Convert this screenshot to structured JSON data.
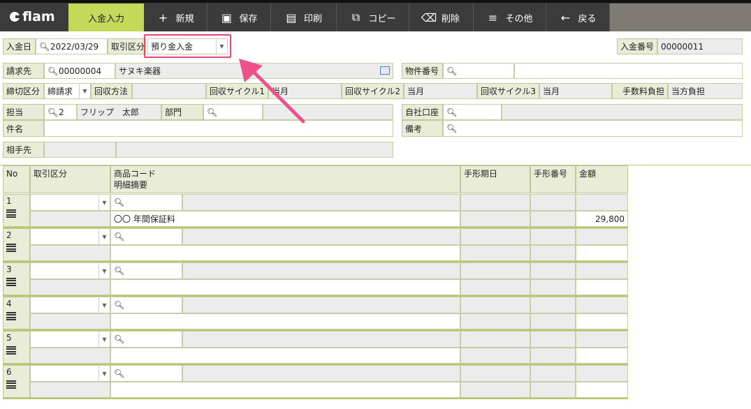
{
  "toolbar": {
    "logo": "flam",
    "tabs": [
      {
        "label": "入金入力",
        "icon": ""
      },
      {
        "label": "新規",
        "icon": "+"
      },
      {
        "label": "保存",
        "icon": "💾"
      },
      {
        "label": "印刷",
        "icon": "🖨"
      },
      {
        "label": "コピー",
        "icon": "⧉"
      },
      {
        "label": "削除",
        "icon": "🗑"
      },
      {
        "label": "その他",
        "icon": "≡"
      },
      {
        "label": "戻る",
        "icon": "←"
      }
    ]
  },
  "header": {
    "date_label": "入金日",
    "date_value": "2022/03/29",
    "type_label": "取引区分",
    "type_value": "預り金入金",
    "number_label": "入金番号",
    "number_value": "00000011"
  },
  "billing": {
    "label": "請求先",
    "code": "00000004",
    "name": "サヌキ楽器",
    "property_label": "物件番号"
  },
  "closing": {
    "label": "締切区分",
    "value": "締請求",
    "method_label": "回収方法",
    "cycle1_label": "回収サイクル1",
    "cycle1_value": "当月",
    "cycle2_label": "回収サイクル2",
    "cycle2_value": "当月",
    "cycle3_label": "回収サイクル3",
    "cycle3_value": "当月",
    "fee_label": "手数料負担",
    "fee_value": "当方負担"
  },
  "staff": {
    "label": "担当",
    "code": "2",
    "name": "フリップ　太郎",
    "dept_label": "部門",
    "account_label": "自社口座"
  },
  "subject": {
    "label": "件名",
    "note_label": "備考"
  },
  "partner": {
    "label": "相手先"
  },
  "table": {
    "headers": {
      "no": "No",
      "type": "取引区分",
      "product": "商品コード",
      "summary": "明細摘要",
      "due": "手形期日",
      "bill_no": "手形番号",
      "amount": "金額"
    },
    "rows": [
      {
        "no": "1",
        "summary": "〇〇 年間保証料",
        "amount": "29,800"
      },
      {
        "no": "2",
        "summary": "",
        "amount": ""
      },
      {
        "no": "3",
        "summary": "",
        "amount": ""
      },
      {
        "no": "4",
        "summary": "",
        "amount": ""
      },
      {
        "no": "5",
        "summary": "",
        "amount": ""
      },
      {
        "no": "6",
        "summary": "",
        "amount": ""
      }
    ]
  },
  "colors": {
    "accent": "#c4d95a",
    "highlight": "#e8447a",
    "toolbar": "#3b3b3b"
  }
}
